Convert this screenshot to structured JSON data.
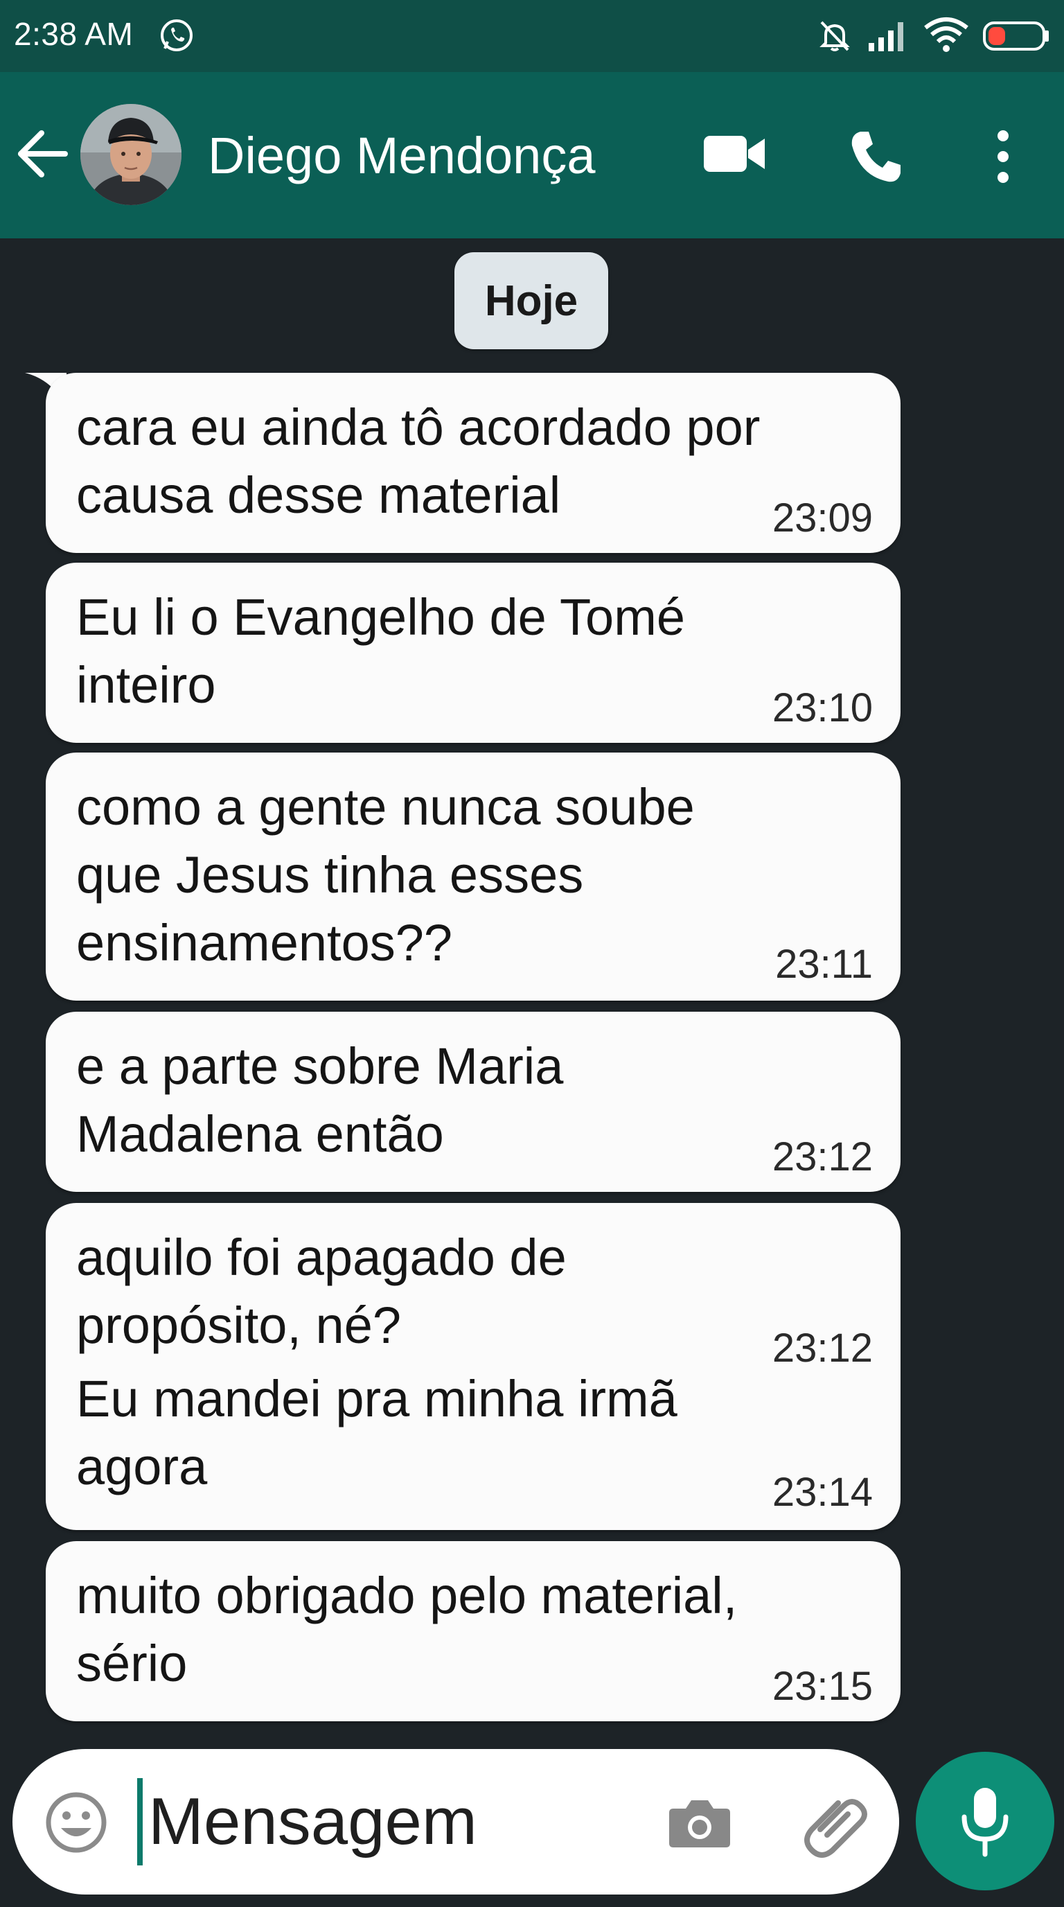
{
  "status_bar": {
    "time": "2:38 AM",
    "icons": [
      "whatsapp-icon",
      "mute-icon",
      "signal-icon",
      "wifi-icon",
      "battery-icon"
    ]
  },
  "header": {
    "contact_name": "Diego Mendonça",
    "icons": [
      "back-arrow-icon",
      "video-call-icon",
      "voice-call-icon",
      "more-options-icon"
    ]
  },
  "date_chip": "Hoje",
  "messages": [
    {
      "lines": [
        "cara eu ainda tô acordado por",
        "causa desse material"
      ],
      "time": "23:09"
    },
    {
      "lines": [
        "Eu li o Evangelho de Tomé",
        "inteiro"
      ],
      "time": "23:10"
    },
    {
      "lines": [
        "como a gente nunca soube",
        "que Jesus tinha esses",
        "ensinamentos??"
      ],
      "time": "23:11"
    },
    {
      "lines": [
        "e a parte sobre Maria",
        "Madalena então"
      ],
      "time": "23:12"
    },
    {
      "lines": [
        "aquilo foi apagado de",
        "propósito, né?"
      ],
      "time": "23:12"
    },
    {
      "lines": [
        "Eu mandei pra minha irmã",
        "agora"
      ],
      "time": "23:14"
    },
    {
      "lines": [
        "muito obrigado pelo material,",
        "sério"
      ],
      "time": "23:15"
    }
  ],
  "composer": {
    "placeholder": "Mensagem",
    "icons": [
      "emoji-icon",
      "camera-icon",
      "attach-icon",
      "mic-icon"
    ]
  },
  "colors": {
    "header": "#0b5f55",
    "status_bar": "#0f4f47",
    "chat_background": "#1d2327",
    "bubble": "#fbfbfb",
    "mic_button": "#0d8f77"
  }
}
